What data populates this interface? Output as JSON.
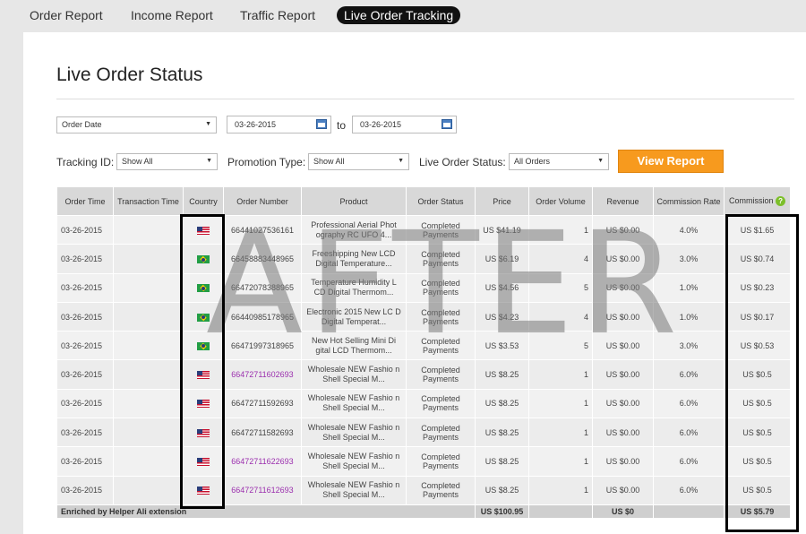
{
  "nav": {
    "tabs": [
      {
        "label": "Order Report"
      },
      {
        "label": "Income Report"
      },
      {
        "label": "Traffic Report"
      },
      {
        "label": "Live Order Tracking"
      }
    ]
  },
  "page": {
    "title": "Live Order Status"
  },
  "filters": {
    "date_type": "Order Date",
    "date_from": "03-26-2015",
    "to_label": "to",
    "date_to": "03-26-2015",
    "tracking_label": "Tracking ID:",
    "tracking_value": "Show All",
    "promo_label": "Promotion Type:",
    "promo_value": "Show All",
    "status_label": "Live Order Status:",
    "status_value": "All Orders",
    "view_button": "View Report"
  },
  "table": {
    "headers": [
      "Order Time",
      "Transaction Time",
      "Country",
      "Order Number",
      "Product",
      "Order Status",
      "Price",
      "Order Volume",
      "Revenue",
      "Commission Rate",
      "Commission"
    ],
    "rows": [
      {
        "time": "03-26-2015",
        "tx": "",
        "flag": "us",
        "order": "66441027536161",
        "product": "Professional Aerial Phot ography RC UFO 4...",
        "status": "Completed Payments",
        "price": "US $41.19",
        "volume": "1",
        "revenue": "US $0.00",
        "rate": "4.0%",
        "commission": "US $1.65"
      },
      {
        "time": "03-26-2015",
        "tx": "",
        "flag": "br",
        "order": "66458883448965",
        "product": "Freeshipping New LCD Digital Temperature...",
        "status": "Completed Payments",
        "price": "US $6.19",
        "volume": "4",
        "revenue": "US $0.00",
        "rate": "3.0%",
        "commission": "US $0.74"
      },
      {
        "time": "03-26-2015",
        "tx": "",
        "flag": "br",
        "order": "66472078388965",
        "product": "Temperature Humidity L CD Digital Thermom...",
        "status": "Completed Payments",
        "price": "US $4.56",
        "volume": "5",
        "revenue": "US $0.00",
        "rate": "1.0%",
        "commission": "US $0.23"
      },
      {
        "time": "03-26-2015",
        "tx": "",
        "flag": "br",
        "order": "66440985178965",
        "product": "Electronic 2015 New LC D Digital Temperat...",
        "status": "Completed Payments",
        "price": "US $4.23",
        "volume": "4",
        "revenue": "US $0.00",
        "rate": "1.0%",
        "commission": "US $0.17"
      },
      {
        "time": "03-26-2015",
        "tx": "",
        "flag": "br",
        "order": "66471997318965",
        "product": "New Hot Selling Mini Di gital LCD Thermom...",
        "status": "Completed Payments",
        "price": "US $3.53",
        "volume": "5",
        "revenue": "US $0.00",
        "rate": "3.0%",
        "commission": "US $0.53"
      },
      {
        "time": "03-26-2015",
        "tx": "",
        "flag": "us",
        "order": "66472711602693",
        "product": "Wholesale NEW Fashio n Shell Special M...",
        "status": "Completed Payments",
        "price": "US $8.25",
        "volume": "1",
        "revenue": "US $0.00",
        "rate": "6.0%",
        "commission": "US $0.5"
      },
      {
        "time": "03-26-2015",
        "tx": "",
        "flag": "us",
        "order": "66472711592693",
        "product": "Wholesale NEW Fashio n Shell Special M...",
        "status": "Completed Payments",
        "price": "US $8.25",
        "volume": "1",
        "revenue": "US $0.00",
        "rate": "6.0%",
        "commission": "US $0.5"
      },
      {
        "time": "03-26-2015",
        "tx": "",
        "flag": "us",
        "order": "66472711582693",
        "product": "Wholesale NEW Fashio n Shell Special M...",
        "status": "Completed Payments",
        "price": "US $8.25",
        "volume": "1",
        "revenue": "US $0.00",
        "rate": "6.0%",
        "commission": "US $0.5"
      },
      {
        "time": "03-26-2015",
        "tx": "",
        "flag": "us",
        "order": "66472711622693",
        "product": "Wholesale NEW Fashio n Shell Special M...",
        "status": "Completed Payments",
        "price": "US $8.25",
        "volume": "1",
        "revenue": "US $0.00",
        "rate": "6.0%",
        "commission": "US $0.5"
      },
      {
        "time": "03-26-2015",
        "tx": "",
        "flag": "us",
        "order": "66472711612693",
        "product": "Wholesale NEW Fashio n Shell Special M...",
        "status": "Completed Payments",
        "price": "US $8.25",
        "volume": "1",
        "revenue": "US $0.00",
        "rate": "6.0%",
        "commission": "US $0.5"
      }
    ],
    "footer": {
      "label": "Enriched by Helper Ali extension",
      "price": "US $100.95",
      "revenue": "US $0",
      "commission": "US $5.79"
    }
  },
  "watermark": "AFTER",
  "colors": {
    "accent": "#f79a1e",
    "status": "#e8492c",
    "link": "#2a5db0",
    "order_green": "#2f8a2f",
    "order_purple": "#9b2fae"
  }
}
